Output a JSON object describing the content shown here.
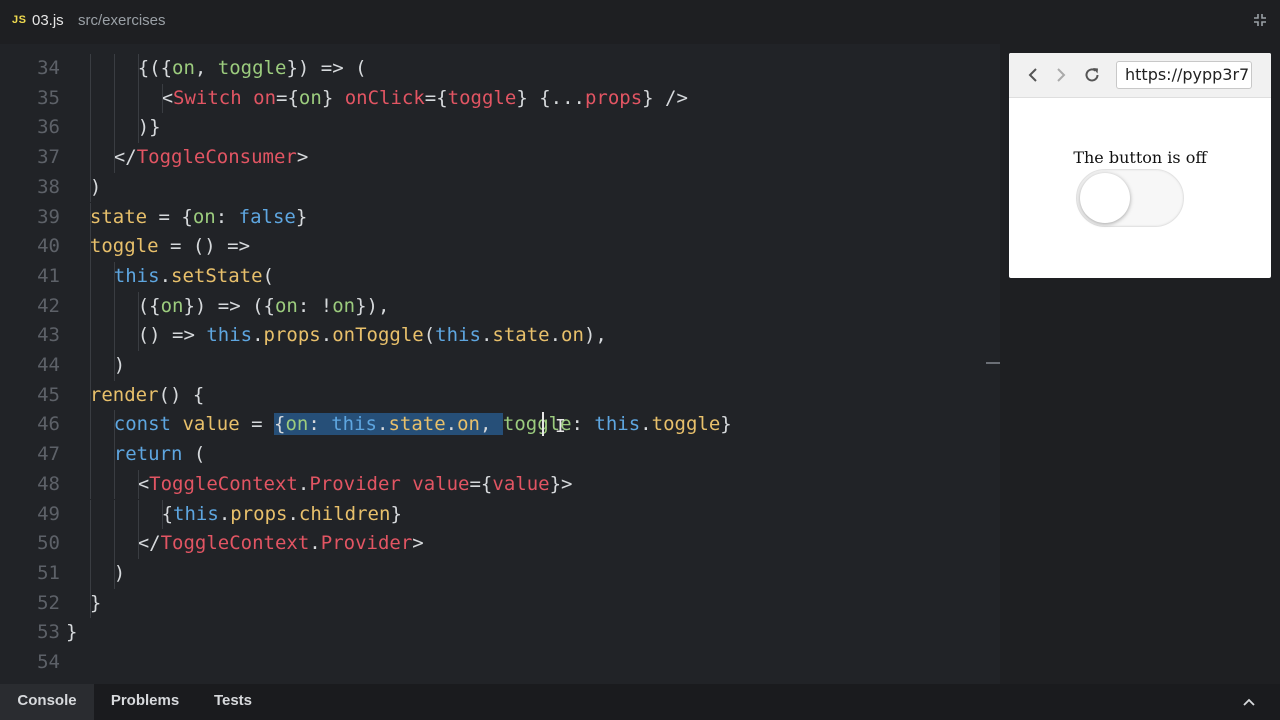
{
  "topbar": {
    "file_badge": "JS",
    "file_name": "03.js",
    "file_path": "src/exercises"
  },
  "editor": {
    "lines": [
      {
        "n": "34",
        "indent": 3,
        "tokens": [
          [
            "punc",
            "{({"
          ],
          [
            "prop",
            "on"
          ],
          [
            "punc",
            ", "
          ],
          [
            "prop",
            "toggle"
          ],
          [
            "punc",
            "}) => ("
          ]
        ]
      },
      {
        "n": "35",
        "indent": 4,
        "tokens": [
          [
            "punc",
            "<"
          ],
          [
            "tag",
            "Switch"
          ],
          [
            "punc",
            " "
          ],
          [
            "attr",
            "on"
          ],
          [
            "punc",
            "={"
          ],
          [
            "prop",
            "on"
          ],
          [
            "punc",
            "} "
          ],
          [
            "attr",
            "onClick"
          ],
          [
            "punc",
            "={"
          ],
          [
            "attr",
            "toggle"
          ],
          [
            "punc",
            "} {..."
          ],
          [
            "attr",
            "props"
          ],
          [
            "punc",
            "} />"
          ]
        ]
      },
      {
        "n": "36",
        "indent": 3,
        "tokens": [
          [
            "punc",
            ")}"
          ]
        ]
      },
      {
        "n": "37",
        "indent": 2,
        "tokens": [
          [
            "punc",
            "</"
          ],
          [
            "tag",
            "ToggleConsumer"
          ],
          [
            "punc",
            ">"
          ]
        ]
      },
      {
        "n": "38",
        "indent": 1,
        "tokens": [
          [
            "punc",
            ")"
          ]
        ]
      },
      {
        "n": "39",
        "indent": 1,
        "tokens": [
          [
            "var",
            "state"
          ],
          [
            "punc",
            " = {"
          ],
          [
            "prop",
            "on"
          ],
          [
            "punc",
            ": "
          ],
          [
            "bool",
            "false"
          ],
          [
            "punc",
            "}"
          ]
        ]
      },
      {
        "n": "40",
        "indent": 1,
        "tokens": [
          [
            "var",
            "toggle"
          ],
          [
            "punc",
            " = () =>"
          ]
        ]
      },
      {
        "n": "41",
        "indent": 2,
        "tokens": [
          [
            "kw",
            "this"
          ],
          [
            "punc",
            "."
          ],
          [
            "fn",
            "setState"
          ],
          [
            "punc",
            "("
          ]
        ]
      },
      {
        "n": "42",
        "indent": 3,
        "tokens": [
          [
            "punc",
            "({"
          ],
          [
            "prop",
            "on"
          ],
          [
            "punc",
            "}) => ({"
          ],
          [
            "prop",
            "on"
          ],
          [
            "punc",
            ": !"
          ],
          [
            "prop",
            "on"
          ],
          [
            "punc",
            "}),"
          ]
        ]
      },
      {
        "n": "43",
        "indent": 3,
        "tokens": [
          [
            "punc",
            "() => "
          ],
          [
            "kw",
            "this"
          ],
          [
            "punc",
            "."
          ],
          [
            "fn",
            "props"
          ],
          [
            "punc",
            "."
          ],
          [
            "fn",
            "onToggle"
          ],
          [
            "punc",
            "("
          ],
          [
            "kw",
            "this"
          ],
          [
            "punc",
            "."
          ],
          [
            "fn",
            "state"
          ],
          [
            "punc",
            "."
          ],
          [
            "fn",
            "on"
          ],
          [
            "punc",
            "),"
          ]
        ]
      },
      {
        "n": "44",
        "indent": 2,
        "tokens": [
          [
            "punc",
            ")"
          ]
        ]
      },
      {
        "n": "45",
        "indent": 1,
        "tokens": [
          [
            "fn",
            "render"
          ],
          [
            "punc",
            "() {"
          ]
        ]
      },
      {
        "n": "46",
        "indent": 2,
        "tokens": [
          [
            "kw",
            "const"
          ],
          [
            "punc",
            " "
          ],
          [
            "var",
            "value"
          ],
          [
            "punc",
            " = "
          ],
          [
            "selpunc",
            "{"
          ],
          [
            "selprop",
            "on"
          ],
          [
            "selpunc",
            ": "
          ],
          [
            "selkw",
            "this"
          ],
          [
            "selpunc",
            "."
          ],
          [
            "selfn",
            "state"
          ],
          [
            "selpunc",
            "."
          ],
          [
            "selfn",
            "on"
          ],
          [
            "selpunc",
            ", "
          ],
          [
            "prop",
            "toggle"
          ],
          [
            "punc",
            ": "
          ],
          [
            "kw",
            "this"
          ],
          [
            "punc",
            "."
          ],
          [
            "fn",
            "toggle"
          ],
          [
            "punc",
            "}"
          ]
        ]
      },
      {
        "n": "47",
        "indent": 2,
        "tokens": [
          [
            "kw",
            "return"
          ],
          [
            "punc",
            " ("
          ]
        ]
      },
      {
        "n": "48",
        "indent": 3,
        "tokens": [
          [
            "punc",
            "<"
          ],
          [
            "tag",
            "ToggleContext"
          ],
          [
            "punc",
            "."
          ],
          [
            "tag",
            "Provider"
          ],
          [
            "punc",
            " "
          ],
          [
            "attr",
            "value"
          ],
          [
            "punc",
            "={"
          ],
          [
            "attr",
            "value"
          ],
          [
            "punc",
            "}>"
          ]
        ]
      },
      {
        "n": "49",
        "indent": 4,
        "tokens": [
          [
            "punc",
            "{"
          ],
          [
            "kw",
            "this"
          ],
          [
            "punc",
            "."
          ],
          [
            "fn",
            "props"
          ],
          [
            "punc",
            "."
          ],
          [
            "fn",
            "children"
          ],
          [
            "punc",
            "}"
          ]
        ]
      },
      {
        "n": "50",
        "indent": 3,
        "tokens": [
          [
            "punc",
            "</"
          ],
          [
            "tag",
            "ToggleContext"
          ],
          [
            "punc",
            "."
          ],
          [
            "tag",
            "Provider"
          ],
          [
            "punc",
            ">"
          ]
        ]
      },
      {
        "n": "51",
        "indent": 2,
        "tokens": [
          [
            "punc",
            ")"
          ]
        ]
      },
      {
        "n": "52",
        "indent": 1,
        "tokens": [
          [
            "punc",
            "}"
          ]
        ]
      },
      {
        "n": "53",
        "indent": 0,
        "tokens": [
          [
            "punc",
            "}"
          ]
        ]
      },
      {
        "n": "54",
        "indent": 0,
        "tokens": []
      }
    ]
  },
  "preview": {
    "url": "https://pypp3r7",
    "status_text": "The button is off",
    "switch_on": false
  },
  "bottom_tabs": [
    {
      "label": "Console",
      "active": true
    },
    {
      "label": "Problems",
      "active": false
    },
    {
      "label": "Tests",
      "active": false
    }
  ]
}
